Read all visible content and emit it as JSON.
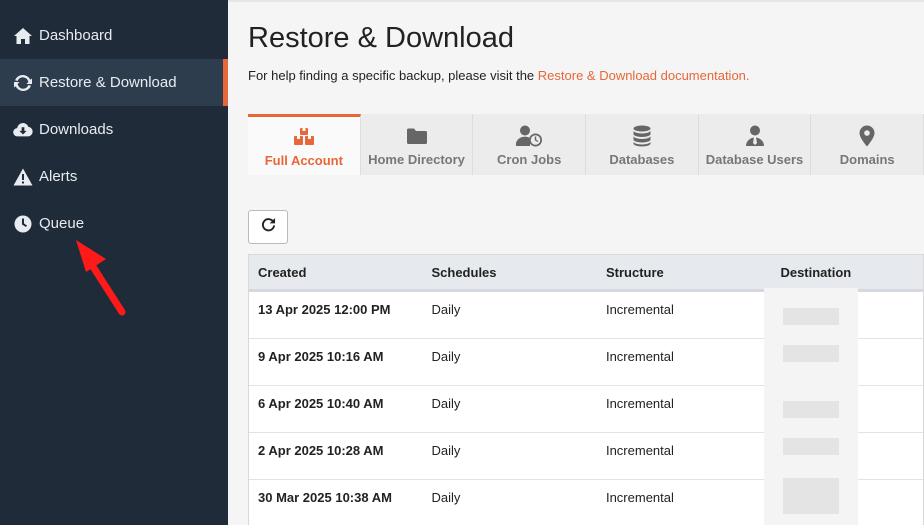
{
  "sidebar": {
    "items": [
      {
        "label": "Dashboard",
        "icon": "home-icon"
      },
      {
        "label": "Restore & Download",
        "icon": "refresh-icon",
        "active": true
      },
      {
        "label": "Downloads",
        "icon": "cloud-download-icon"
      },
      {
        "label": "Alerts",
        "icon": "warning-icon"
      },
      {
        "label": "Queue",
        "icon": "clock-icon"
      }
    ]
  },
  "main": {
    "title": "Restore & Download",
    "help_text": "For help finding a specific backup, please visit the ",
    "help_link": "Restore & Download documentation.",
    "tabs": [
      {
        "label": "Full Account",
        "icon": "boxes-icon",
        "active": true
      },
      {
        "label": "Home Directory",
        "icon": "folder-icon"
      },
      {
        "label": "Cron Jobs",
        "icon": "user-clock-icon"
      },
      {
        "label": "Databases",
        "icon": "database-icon"
      },
      {
        "label": "Database Users",
        "icon": "user-tie-icon"
      },
      {
        "label": "Domains",
        "icon": "map-marker-icon"
      }
    ],
    "table": {
      "headers": [
        "Created",
        "Schedules",
        "Structure",
        "Destination"
      ],
      "rows": [
        {
          "created": "13 Apr 2025 12:00 PM",
          "schedule": "Daily",
          "structure": "Incremental"
        },
        {
          "created": "9 Apr 2025 10:16 AM",
          "schedule": "Daily",
          "structure": "Incremental"
        },
        {
          "created": "6 Apr 2025 10:40 AM",
          "schedule": "Daily",
          "structure": "Incremental"
        },
        {
          "created": "2 Apr 2025 10:28 AM",
          "schedule": "Daily",
          "structure": "Incremental"
        },
        {
          "created": "30 Mar 2025 10:38 AM",
          "schedule": "Daily",
          "structure": "Incremental"
        }
      ]
    }
  },
  "colors": {
    "accent": "#e8673a",
    "sidebar_bg": "#1f2b38",
    "arrow": "#ff0000"
  }
}
